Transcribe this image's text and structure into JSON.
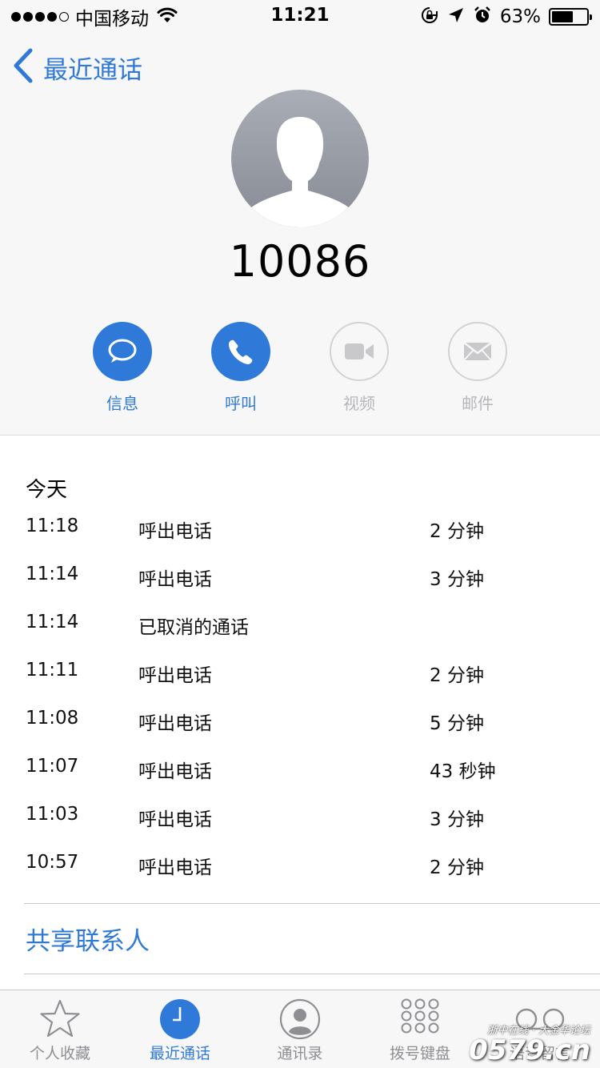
{
  "status_bar": {
    "carrier": "中国移动",
    "time": "11:21",
    "battery_percent": "63%",
    "battery_level": 0.63,
    "icons": [
      "signal-dots",
      "wifi-icon",
      "rotation-lock-icon",
      "location-icon",
      "alarm-icon",
      "battery-icon"
    ]
  },
  "nav": {
    "back_label": "最近通话"
  },
  "contact": {
    "number": "10086"
  },
  "actions": [
    {
      "label": "信息",
      "icon": "message-icon",
      "enabled": true
    },
    {
      "label": "呼叫",
      "icon": "phone-icon",
      "enabled": true
    },
    {
      "label": "视频",
      "icon": "video-icon",
      "enabled": false
    },
    {
      "label": "邮件",
      "icon": "mail-icon",
      "enabled": false
    }
  ],
  "history": {
    "section_title": "今天",
    "rows": [
      {
        "time": "11:18",
        "kind": "呼出电话",
        "duration": "2 分钟"
      },
      {
        "time": "11:14",
        "kind": "呼出电话",
        "duration": "3 分钟"
      },
      {
        "time": "11:14",
        "kind": "已取消的通话",
        "duration": ""
      },
      {
        "time": "11:11",
        "kind": "呼出电话",
        "duration": "2 分钟"
      },
      {
        "time": "11:08",
        "kind": "呼出电话",
        "duration": "5 分钟"
      },
      {
        "time": "11:07",
        "kind": "呼出电话",
        "duration": "43 秒钟"
      },
      {
        "time": "11:03",
        "kind": "呼出电话",
        "duration": "3 分钟"
      },
      {
        "time": "10:57",
        "kind": "呼出电话",
        "duration": "2 分钟"
      }
    ]
  },
  "share_contact": "共享联系人",
  "tabs": [
    {
      "label": "个人收藏",
      "icon": "star-icon",
      "active": false
    },
    {
      "label": "最近通话",
      "icon": "clock-icon",
      "active": true
    },
    {
      "label": "通讯录",
      "icon": "contacts-icon",
      "active": false
    },
    {
      "label": "拨号键盘",
      "icon": "keypad-icon",
      "active": false
    },
    {
      "label": "语音留言",
      "icon": "voicemail-icon",
      "active": false
    }
  ],
  "watermark": {
    "top": "浙中在线 · 大金华论坛",
    "main": "0579.cn"
  },
  "colors": {
    "accent": "#2f7ad9",
    "disabled": "#b7b7bb",
    "background": "#f7f7f8"
  }
}
